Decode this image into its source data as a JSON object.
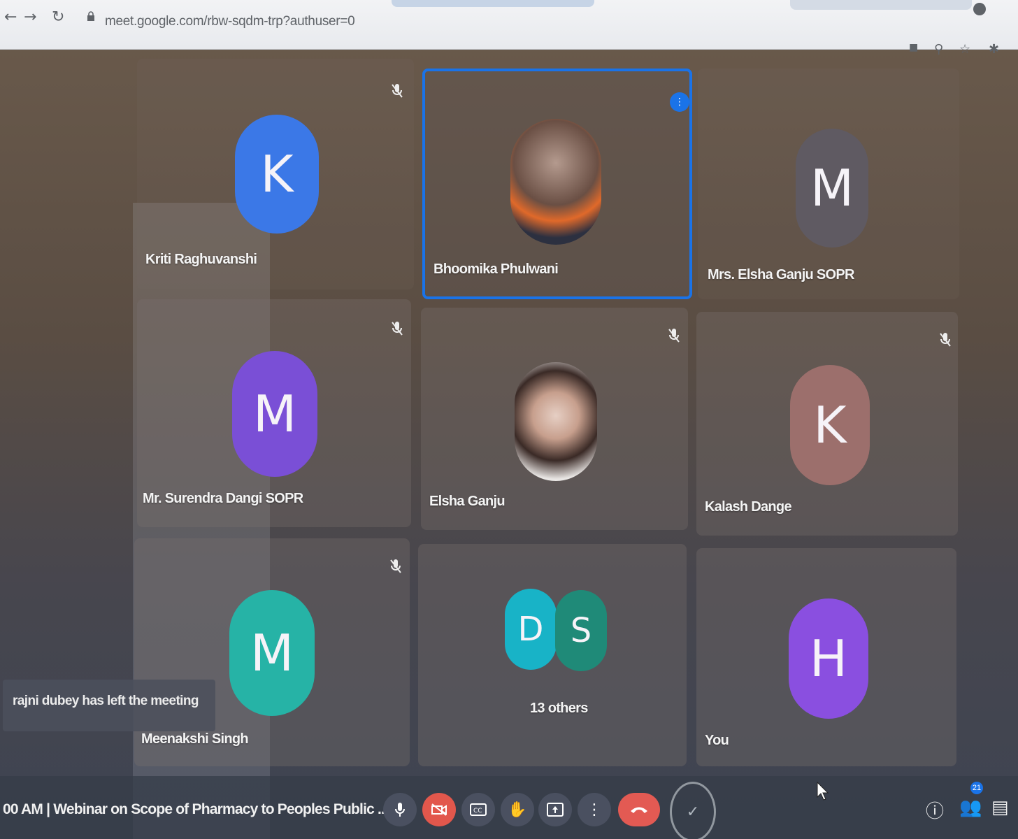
{
  "browser": {
    "url": "meet.google.com/rbw-sqdm-trp?authuser=0"
  },
  "participants": [
    {
      "name": "Kriti Raghuvanshi",
      "initial": "K",
      "color": "#3b78e7",
      "muted": true
    },
    {
      "name": "Bhoomika Phulwani",
      "initial": "",
      "color": "#e8722a",
      "muted": false,
      "speaking": true,
      "photo": true
    },
    {
      "name": "Mrs. Elsha Ganju SOPR",
      "initial": "M",
      "color": "#5f5a62",
      "muted": false
    },
    {
      "name": "Mr. Surendra Dangi SOPR",
      "initial": "M",
      "color": "#7a4fd6",
      "muted": true
    },
    {
      "name": "Elsha Ganju",
      "initial": "",
      "color": "#c9c4c8",
      "muted": true,
      "photo": true
    },
    {
      "name": "Kalash Dange",
      "initial": "K",
      "color": "#9c6f6c",
      "muted": true
    },
    {
      "name": "Meenakshi Singh",
      "initial": "M",
      "color": "#26b3a6",
      "muted": true
    },
    {
      "name": "13 others",
      "initial": "D",
      "initial2": "S",
      "color": "#18b3c7",
      "color2": "#1f8a78"
    },
    {
      "name": "You",
      "initial": "H",
      "color": "#8a4fe0"
    }
  ],
  "notification": {
    "text": "rajni dubey has left the meeting"
  },
  "bottom_bar": {
    "meeting_info": "00 AM  |  Webinar on Scope of Pharmacy to Peoples Public ...",
    "participant_count": "21",
    "controls": [
      "mic-icon",
      "camera-off-icon",
      "captions-icon",
      "raise-hand-icon",
      "present-icon",
      "more-options-icon",
      "hangup-icon",
      "checkmark-icon"
    ]
  }
}
